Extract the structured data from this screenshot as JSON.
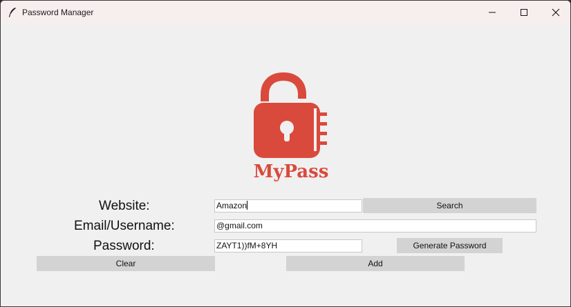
{
  "window": {
    "title": "Password Manager"
  },
  "logo": {
    "text": "MyPass",
    "color": "#d94a3c"
  },
  "form": {
    "website_label": "Website:",
    "email_label": "Email/Username:",
    "password_label": "Password:",
    "website_value": "Amazon",
    "email_value": "@gmail.com",
    "password_value": "ZAYT1))fM+8YH"
  },
  "buttons": {
    "search": "Search",
    "generate": "Generate Password",
    "clear": "Clear",
    "add": "Add"
  }
}
